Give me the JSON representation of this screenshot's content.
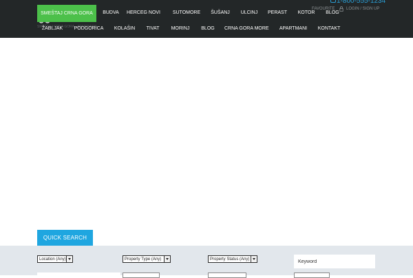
{
  "header": {
    "phone": "1-800-555-1234",
    "logo_tagline": "SMEŠTAJ CRNA GORA · APARTMANI",
    "favourite_label": "FAVOURITE",
    "login_label": "LOGIN / SIGN UP"
  },
  "nav": {
    "row1": [
      "SMEŠTAJ CRNA GORA",
      "BUDVA",
      "HERCEG NOVI",
      "SUTOMORE",
      "ŠUŠANJ",
      "ULCINJ",
      "PERAST",
      "KOTOR",
      "BLOG"
    ],
    "row2": [
      "ŽABLJAK",
      "PODGORICA",
      "KOLAŠIN",
      "TIVAT",
      "MORINJ",
      "BLOG",
      "CRNA GORA MORE",
      "APARTMANI",
      "KONTAKT"
    ]
  },
  "quick_search": {
    "tab_label": "QUICK SEARCH",
    "location": "Location (Any)",
    "property_type": "Property Type (Any)",
    "property_status": "Property Status (Any)",
    "keyword_placeholder": "Keyword"
  },
  "colors": {
    "header_bg": "#232728",
    "active_nav": "#4cc04a",
    "accent_blue": "#1fa6e0",
    "search_band": "#e2e7ec"
  }
}
